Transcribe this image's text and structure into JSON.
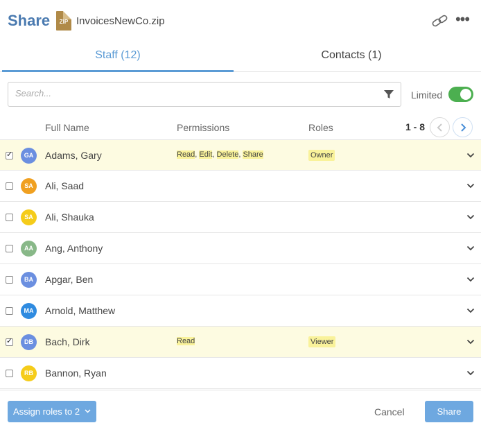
{
  "header": {
    "title": "Share",
    "file_icon_label": "ZIP",
    "filename": "InvoicesNewCo.zip",
    "icons": [
      "link-icon",
      "more-icon"
    ]
  },
  "tabs": [
    {
      "label": "Staff (12)",
      "active": true
    },
    {
      "label": "Contacts (1)",
      "active": false
    }
  ],
  "search": {
    "placeholder": "Search...",
    "value": ""
  },
  "limited": {
    "label": "Limited",
    "on": true,
    "color": "#4caf50"
  },
  "columns": {
    "full_name": "Full Name",
    "permissions": "Permissions",
    "roles": "Roles"
  },
  "pager": {
    "range": "1 - 8"
  },
  "staff": [
    {
      "initials": "GA",
      "name": "Adams, Gary",
      "color": "#6b8fe0",
      "checked": true,
      "permissions": [
        "Read",
        "Edit",
        "Delete",
        "Share"
      ],
      "role": "Owner"
    },
    {
      "initials": "SA",
      "name": "Ali, Saad",
      "color": "#f0a020",
      "checked": false,
      "permissions": [],
      "role": ""
    },
    {
      "initials": "SA",
      "name": "Ali, Shauka",
      "color": "#f5cc1a",
      "checked": false,
      "permissions": [],
      "role": ""
    },
    {
      "initials": "AA",
      "name": "Ang, Anthony",
      "color": "#88b888",
      "checked": false,
      "permissions": [],
      "role": ""
    },
    {
      "initials": "BA",
      "name": "Apgar, Ben",
      "color": "#6b8fe0",
      "checked": false,
      "permissions": [],
      "role": ""
    },
    {
      "initials": "MA",
      "name": "Arnold, Matthew",
      "color": "#2f8be0",
      "checked": false,
      "permissions": [],
      "role": ""
    },
    {
      "initials": "DB",
      "name": "Bach, Dirk",
      "color": "#6b8fe0",
      "checked": true,
      "permissions": [
        "Read"
      ],
      "role": "Viewer"
    },
    {
      "initials": "RB",
      "name": "Bannon, Ryan",
      "color": "#f5cc1a",
      "checked": false,
      "permissions": [],
      "role": ""
    }
  ],
  "footer": {
    "assign_label": "Assign roles to 2",
    "cancel_label": "Cancel",
    "share_label": "Share"
  },
  "colors": {
    "accent": "#5b9bd5",
    "button": "#6ea8e0",
    "highlight": "#f9f29a",
    "selected_row": "#fdfbe1"
  }
}
